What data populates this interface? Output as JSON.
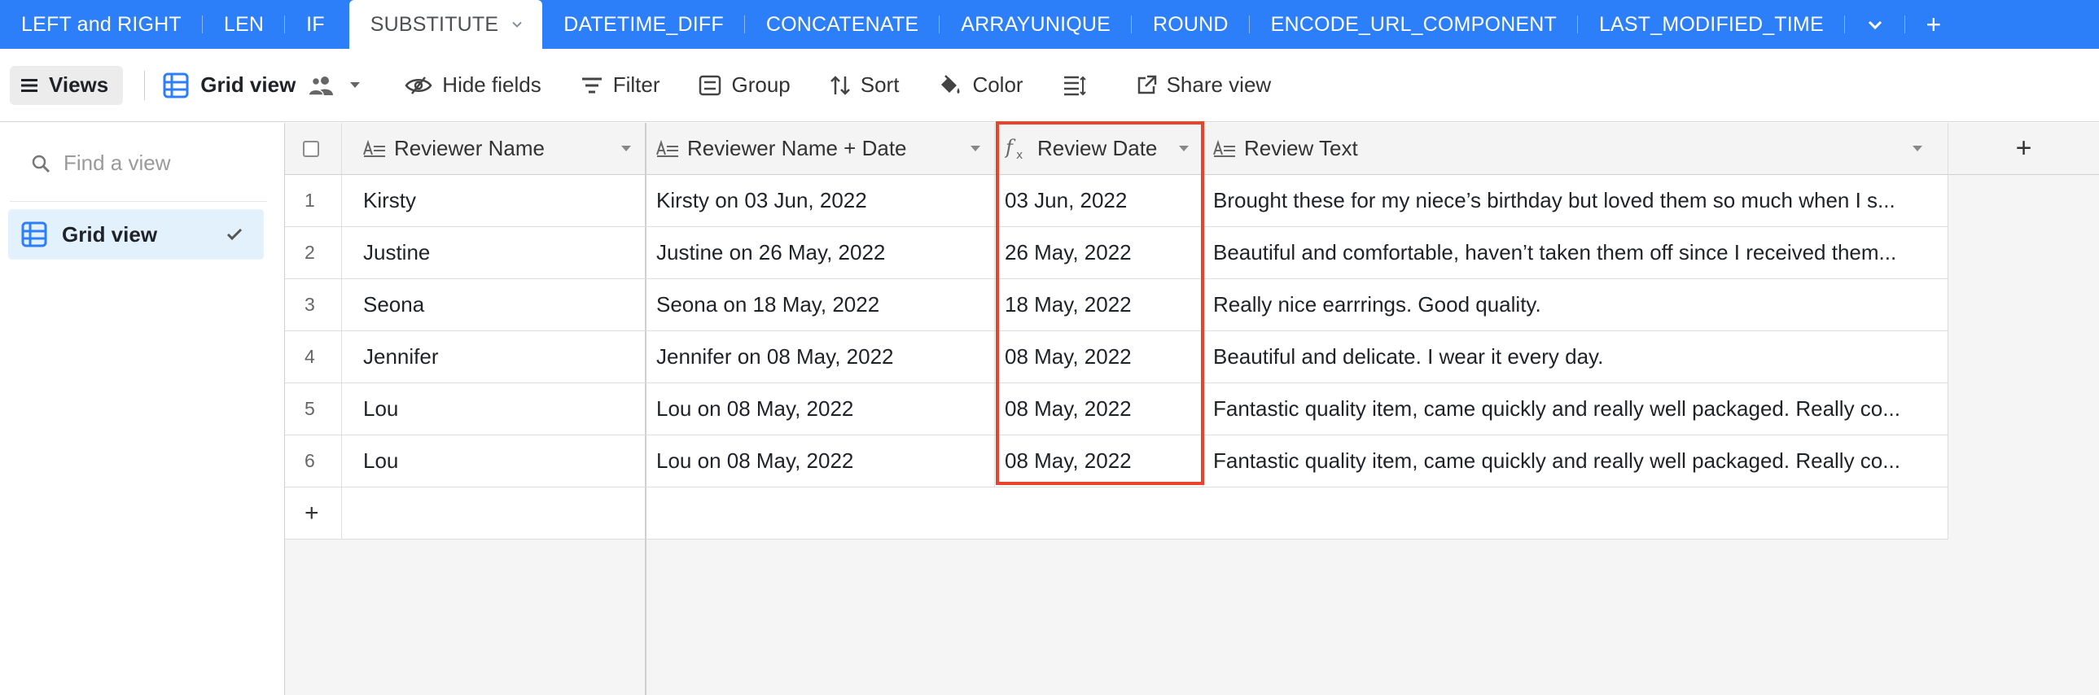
{
  "tabs": {
    "items": [
      {
        "label": "LEFT and RIGHT"
      },
      {
        "label": "LEN"
      },
      {
        "label": "IF"
      },
      {
        "label": "SUBSTITUTE"
      },
      {
        "label": "DATETIME_DIFF"
      },
      {
        "label": "CONCATENATE"
      },
      {
        "label": "ARRAYUNIQUE"
      },
      {
        "label": "ROUND"
      },
      {
        "label": "ENCODE_URL_COMPONENT"
      },
      {
        "label": "LAST_MODIFIED_TIME"
      }
    ],
    "active": "SUBSTITUTE",
    "more_icon": "chevron-down-icon",
    "add_icon": "plus-icon",
    "add_label": "+"
  },
  "toolbar": {
    "views_label": "Views",
    "grid_view_label": "Grid view",
    "hide_fields_label": "Hide fields",
    "filter_label": "Filter",
    "group_label": "Group",
    "sort_label": "Sort",
    "color_label": "Color",
    "share_view_label": "Share view"
  },
  "sidebar": {
    "search_placeholder": "Find a view",
    "items": [
      {
        "label": "Grid view",
        "selected": true
      }
    ]
  },
  "grid": {
    "columns": [
      {
        "label": "Reviewer Name",
        "type_icon": "long-text-icon"
      },
      {
        "label": "Reviewer Name + Date",
        "type_icon": "long-text-icon"
      },
      {
        "label": "Review Date",
        "type_icon": "formula-icon",
        "highlighted": true
      },
      {
        "label": "Review Text",
        "type_icon": "long-text-icon"
      }
    ],
    "add_column_label": "+",
    "add_row_label": "+",
    "rows": [
      {
        "num": "1",
        "name": "Kirsty",
        "name_date": "Kirsty on 03 Jun, 2022",
        "date": "03 Jun, 2022",
        "text": "Brought these for my niece’s birthday but loved them so much when I s..."
      },
      {
        "num": "2",
        "name": "Justine",
        "name_date": "Justine on 26 May, 2022",
        "date": "26 May, 2022",
        "text": "Beautiful and comfortable, haven’t taken them off since I received them..."
      },
      {
        "num": "3",
        "name": "Seona",
        "name_date": "Seona on 18 May, 2022",
        "date": "18 May, 2022",
        "text": "Really nice earrrings. Good quality."
      },
      {
        "num": "4",
        "name": "Jennifer",
        "name_date": "Jennifer on 08 May, 2022",
        "date": "08 May, 2022",
        "text": "Beautiful and delicate. I wear it every day."
      },
      {
        "num": "5",
        "name": "Lou",
        "name_date": "Lou on 08 May, 2022",
        "date": "08 May, 2022",
        "text": "Fantastic quality item, came quickly and really well packaged. Really co..."
      },
      {
        "num": "6",
        "name": "Lou",
        "name_date": "Lou on 08 May, 2022",
        "date": "08 May, 2022",
        "text": "Fantastic quality item, came quickly and really well packaged. Really co..."
      }
    ]
  },
  "colors": {
    "tabbar_bg": "#2d7ff9",
    "highlight_border": "#e8432d",
    "selected_view_bg": "#e3f1fd",
    "grid_icon": "#2d7ff9"
  }
}
